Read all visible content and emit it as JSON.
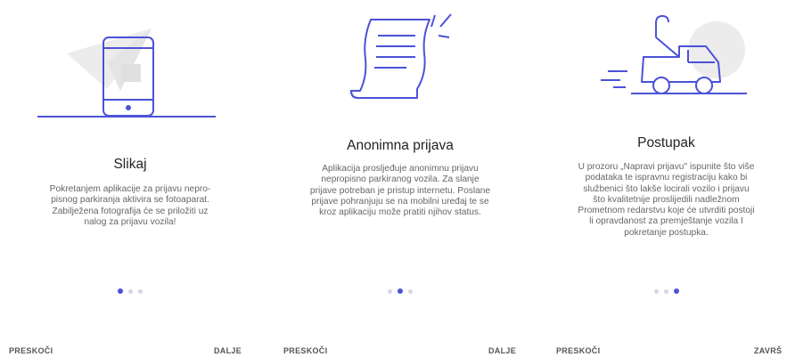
{
  "screens": [
    {
      "title": "Slikaj",
      "description": "Pokretanjem aplikacije za prijavu nepro-\npisnog parkiranja aktivira se fotoaparat.\nZabilježena fotografija će se priložiti uz\nnalog za prijavu vozila!",
      "skip_label": "PRESKOČI",
      "next_label": "DALJE",
      "illustration": "phone-icon",
      "page_index": 0
    },
    {
      "title": "Anonimna prijava",
      "description": "Aplikacija prosljeđuje anonimnu prijavu\nnepropisno parkiranog vozila. Za slanje\nprijave potreban je pristup internetu. Poslane\nprijave pohranjuju se na mobilni uređaj te se\nkroz aplikaciju može pratiti njihov status.",
      "skip_label": "PRESKOČI",
      "next_label": "DALJE",
      "illustration": "document-icon",
      "page_index": 1
    },
    {
      "title": "Postupak",
      "description": "U prozoru „Napravi prijavu\" ispunite što više\npodataka te ispravnu registraciju kako bi\nslužbenici što lakše locirali vozilo i prijavu\nšto kvalitetnije proslijedili nadležnom\nPrometnom redarstvu koje će utvrditi postoji\nli opravdanost za premještanje vozila I\npokretanje postupka.",
      "skip_label": "PRESKOČI",
      "next_label": "ZAVRŠ",
      "illustration": "tow-truck-icon",
      "page_index": 2
    }
  ],
  "colors": {
    "accent": "#4b52d8",
    "dot_inactive": "#d5d5ea",
    "illustration_bg": "#eaeaea"
  }
}
